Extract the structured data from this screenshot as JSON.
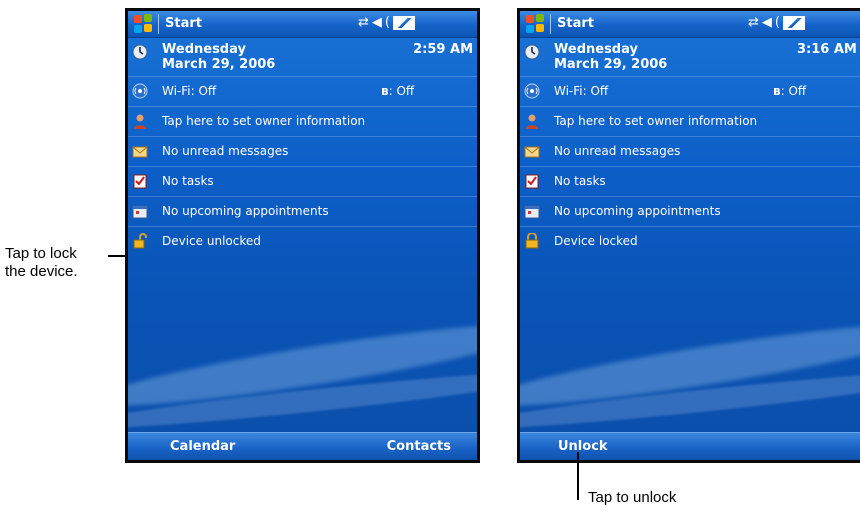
{
  "callouts": {
    "lock_line1": "Tap to lock",
    "lock_line2": "the device.",
    "unlock": "Tap to unlock"
  },
  "devices": [
    {
      "title": "Start",
      "day": "Wednesday",
      "date": "March 29, 2006",
      "time": "2:59 AM",
      "wifi": "Wi-Fi: Off",
      "bluetooth": ": Off",
      "owner": "Tap here to set owner information",
      "messages": "No unread messages",
      "tasks": "No tasks",
      "appointments": "No upcoming appointments",
      "device_status": "Device unlocked",
      "softkey_left": "Calendar",
      "softkey_right": "Contacts"
    },
    {
      "title": "Start",
      "day": "Wednesday",
      "date": "March 29, 2006",
      "time": "3:16 AM",
      "wifi": "Wi-Fi: Off",
      "bluetooth": ": Off",
      "owner": "Tap here to set owner information",
      "messages": "No unread messages",
      "tasks": "No tasks",
      "appointments": "No upcoming appointments",
      "device_status": "Device locked",
      "softkey_left": "Unlock",
      "softkey_right": ""
    }
  ],
  "icons": {
    "clock": "clock-icon",
    "wifi": "wireless-icon",
    "owner": "owner-icon",
    "messages": "envelope-icon",
    "tasks": "tasks-icon",
    "appointments": "calendar-icon",
    "unlocked": "padlock-open-icon",
    "locked": "padlock-closed-icon"
  },
  "colors": {
    "screen_blue": "#0c5fc8",
    "titlebar_blue": "#1766cc",
    "text": "#ffffff"
  }
}
